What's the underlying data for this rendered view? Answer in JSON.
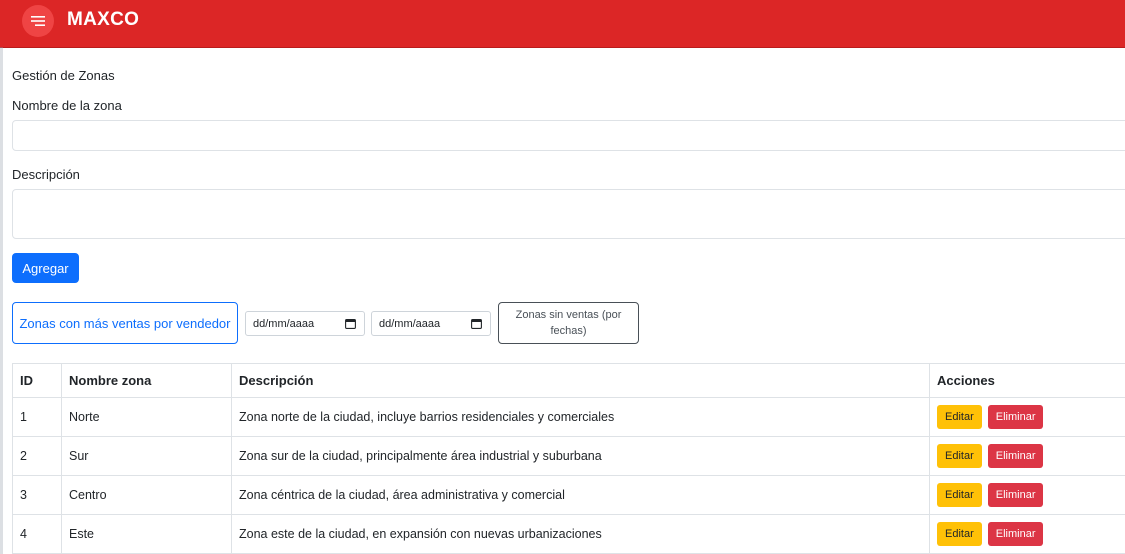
{
  "app": {
    "brand": "MAXCO"
  },
  "page": {
    "heading": "Gestión de Zonas"
  },
  "form": {
    "name_label": "Nombre de la zona",
    "name_value": "",
    "description_label": "Descripción",
    "description_value": "",
    "add_button": "Agregar"
  },
  "filters": {
    "top_zones_button": "Zonas con más ventas por vendedor",
    "date_from_placeholder": "dd/mm/aaaa",
    "date_to_placeholder": "dd/mm/aaaa",
    "no_sales_button": "Zonas sin ventas (por fechas)"
  },
  "table": {
    "headers": [
      "ID",
      "Nombre zona",
      "Descripción",
      "Acciones"
    ],
    "edit_label": "Editar",
    "delete_label": "Eliminar",
    "rows": [
      {
        "id": "1",
        "name": "Norte",
        "description": "Zona norte de la ciudad, incluye barrios residenciales y comerciales"
      },
      {
        "id": "2",
        "name": "Sur",
        "description": "Zona sur de la ciudad, principalmente área industrial y suburbana"
      },
      {
        "id": "3",
        "name": "Centro",
        "description": "Zona céntrica de la ciudad, área administrativa y comercial"
      },
      {
        "id": "4",
        "name": "Este",
        "description": "Zona este de la ciudad, en expansión con nuevas urbanizaciones"
      }
    ]
  },
  "colors": {
    "topbar": "#dc2626",
    "primary": "#0d6efd",
    "warning": "#ffc107",
    "danger": "#dc3545"
  },
  "icons": {
    "menu": "hamburger-menu-icon",
    "calendar": "calendar-icon"
  }
}
